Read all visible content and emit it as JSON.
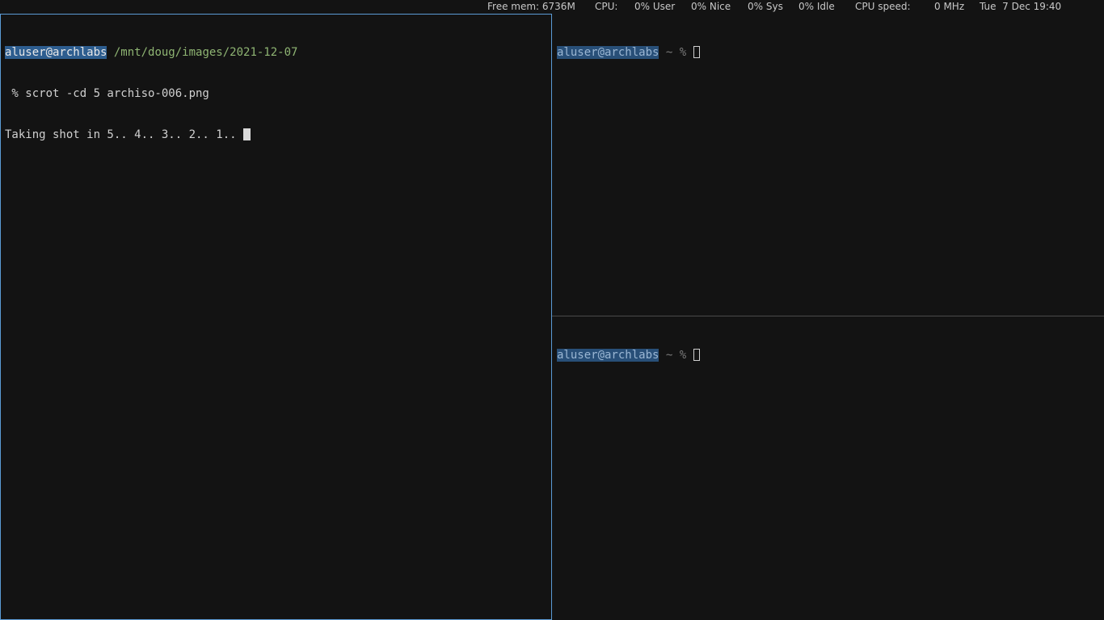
{
  "statusbar": {
    "free_mem": "Free mem: 6736M",
    "cpu_label": "CPU:",
    "user": "0% User",
    "nice": "0% Nice",
    "sys": "0% Sys",
    "idle": "0% Idle",
    "cpu_speed_label": "CPU speed:",
    "cpu_speed": "0 MHz",
    "datetime": "Tue  7 Dec 19:40"
  },
  "left_pane": {
    "prompt_user": "aluser@archlabs",
    "prompt_path": "/mnt/doug/images/2021-12-07",
    "command": " % scrot -cd 5 archiso-006.png",
    "output": "Taking shot in 5.. 4.. 3.. 2.. 1.. "
  },
  "right_top_pane": {
    "prompt_user": "aluser@archlabs",
    "prompt_tail": " ~ % "
  },
  "right_bottom_pane": {
    "prompt_user": "aluser@archlabs",
    "prompt_tail": " ~ % "
  }
}
